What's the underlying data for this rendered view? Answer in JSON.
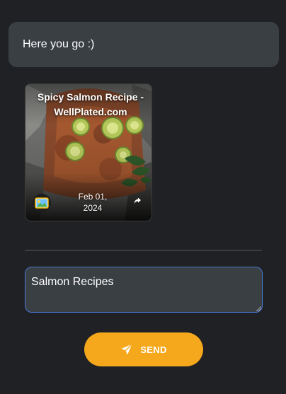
{
  "chat": {
    "message": "Here you go :)"
  },
  "card": {
    "title": "Spicy Salmon Recipe - WellPlated.com",
    "date": "Feb 01, 2024",
    "image_icon": "image-icon",
    "share_icon": "share-icon"
  },
  "composer": {
    "value": "Salmon Recipes",
    "send_label": "SEND",
    "send_icon": "paper-plane-icon"
  },
  "colors": {
    "background": "#202124",
    "bubble": "#3a3f44",
    "accent": "#f5a81c",
    "input_border": "#4a7bd8"
  }
}
